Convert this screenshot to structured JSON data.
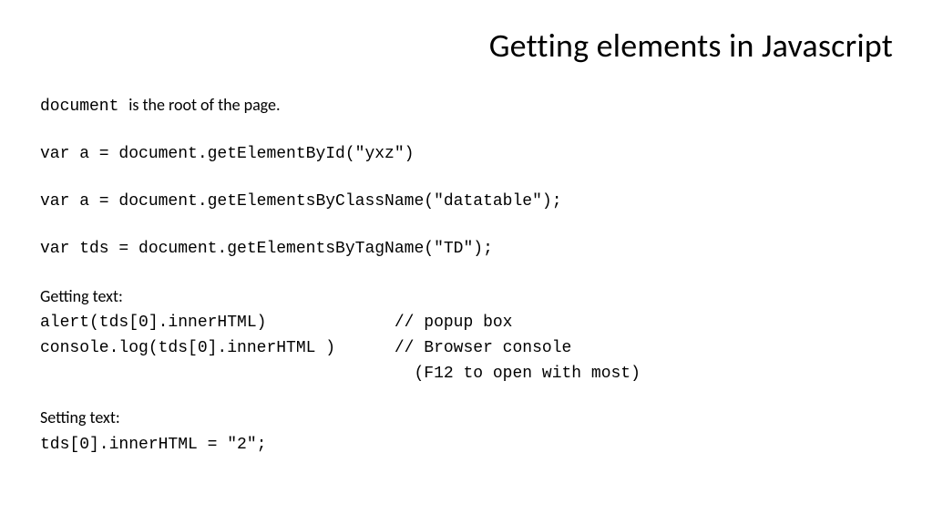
{
  "slide": {
    "title": "Getting elements in Javascript",
    "intro_code": "document ",
    "intro_rest": " is the root of the page.",
    "code_byid": "var a = document.getElementById(\"yxz\")",
    "code_byclass": "var a = document.getElementsByClassName(\"datatable\");",
    "code_bytag": "var tds = document.getElementsByTagName(\"TD\");",
    "getting_label": "Getting text:",
    "getting_line1": "alert(tds[0].innerHTML)             // popup box",
    "getting_line2": "console.log(tds[0].innerHTML )      // Browser console",
    "getting_line3": "                                      (F12 to open with most)",
    "setting_label": "Setting text:",
    "setting_line1": "tds[0].innerHTML = \"2\";"
  }
}
